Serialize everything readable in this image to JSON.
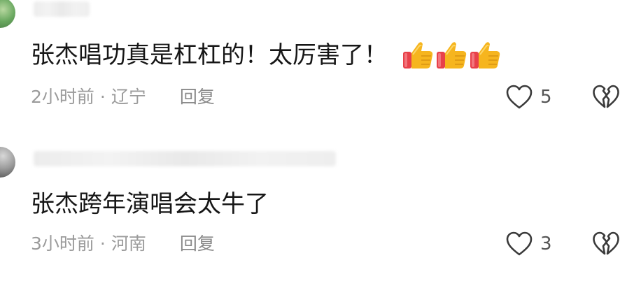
{
  "comments": [
    {
      "text": "张杰唱功真是杠杠的！太厉害了！",
      "emoji": [
        "thumbs-up",
        "thumbs-up",
        "thumbs-up"
      ],
      "time": "2小时前",
      "separator": "·",
      "location": "辽宁",
      "reply_label": "回复",
      "like_count": "5"
    },
    {
      "text": "张杰跨年演唱会太牛了",
      "time": "3小时前",
      "separator": "·",
      "location": "河南",
      "reply_label": "回复",
      "like_count": "3"
    }
  ],
  "icons": {
    "like": "heart-outline-icon",
    "dislike": "broken-heart-icon",
    "emoji": "thumbs-up-icon"
  },
  "colors": {
    "text": "#161616",
    "meta": "#9b9b9b",
    "icon": "#3a3a3a",
    "thumb": "#f6b51e",
    "cuff": "#e8414a"
  }
}
